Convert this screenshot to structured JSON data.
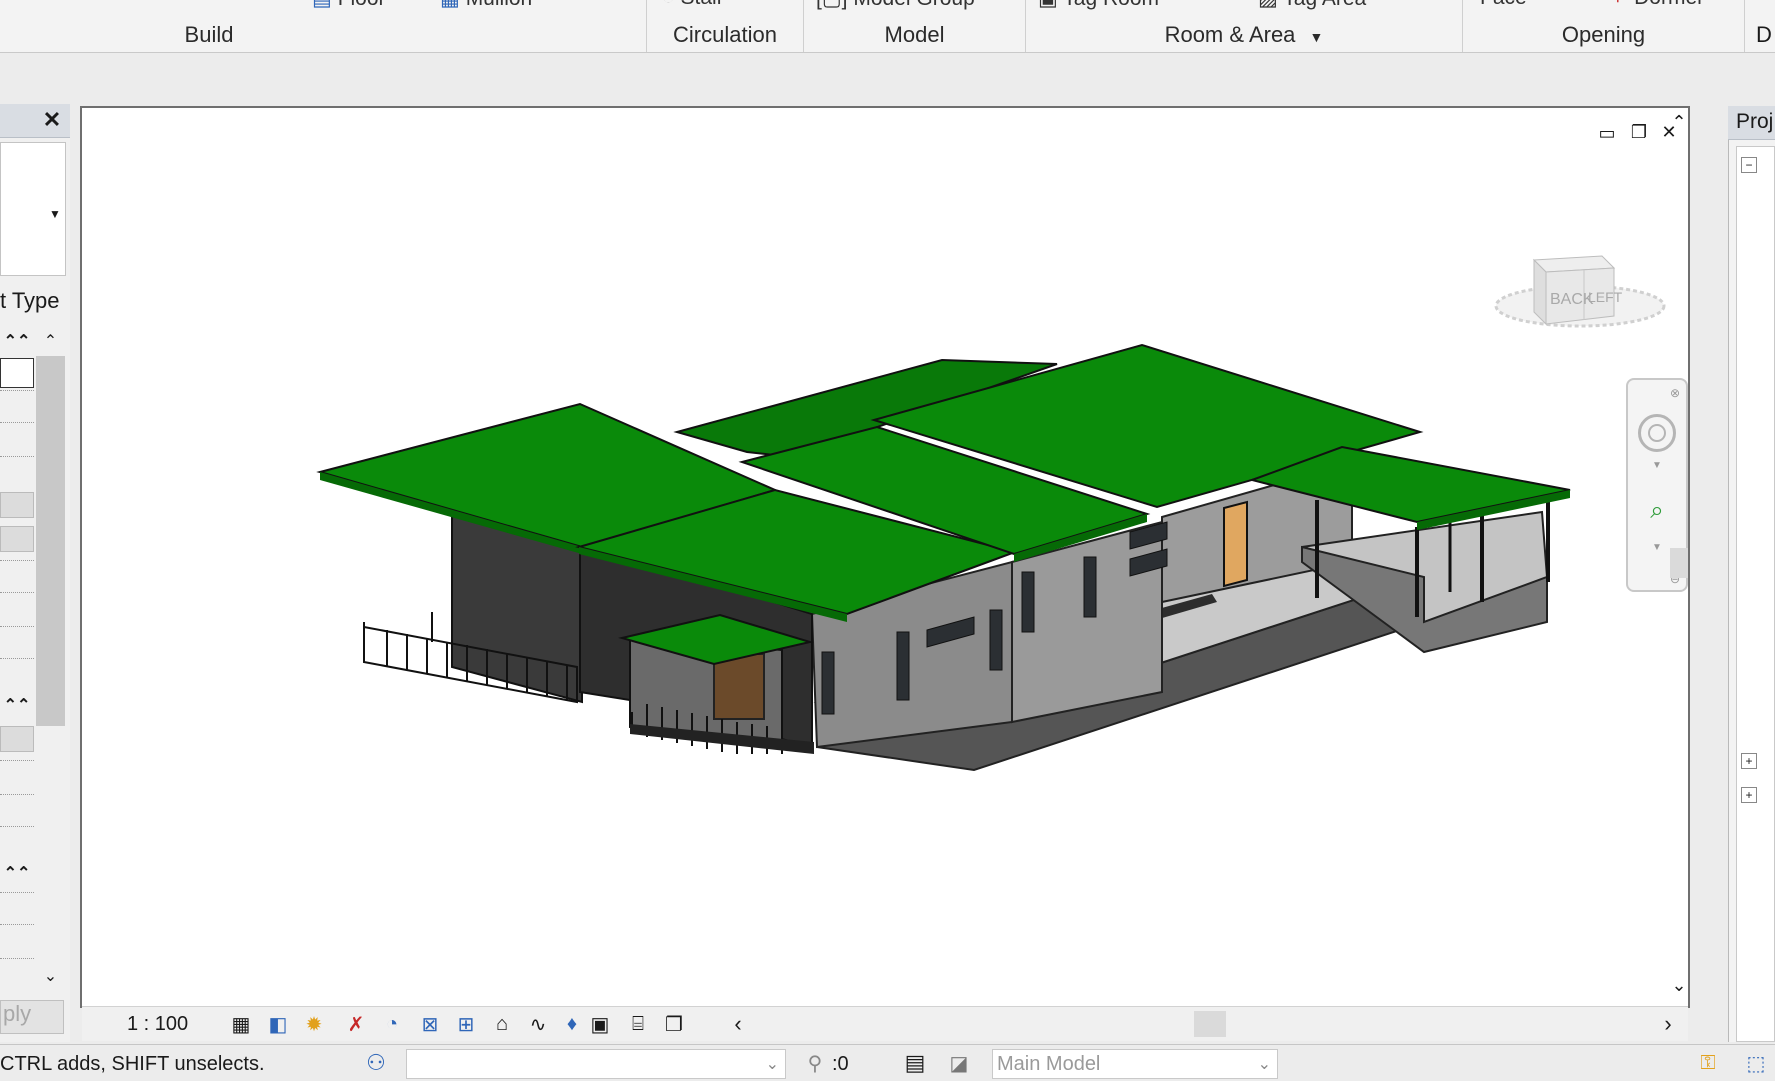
{
  "ribbon": {
    "tools": [
      "Floor",
      "Mullion",
      "Stair",
      "Model Group",
      "Tag Room",
      "Tag Area",
      "Face",
      "Dormer"
    ],
    "panels": {
      "build": "Build",
      "circulation": "Circulation",
      "model": "Model",
      "room_area": "Room & Area",
      "opening": "Opening"
    }
  },
  "properties": {
    "type_label": "t Type",
    "apply": "ply"
  },
  "viewcube": {
    "face_back": "BACK",
    "face_left": "LEFT"
  },
  "view_control_bar": {
    "scale": "1 : 100"
  },
  "project_browser": {
    "title": "Proj"
  },
  "status_bar": {
    "hint": "CTRL adds, SHIFT unselects.",
    "selection_count": ":0",
    "model": "Main Model"
  },
  "colors": {
    "roof": "#0a8a0a",
    "wall": "#8f8f8f",
    "dark_wall": "#3a3a3a",
    "door": "#e0a760"
  }
}
